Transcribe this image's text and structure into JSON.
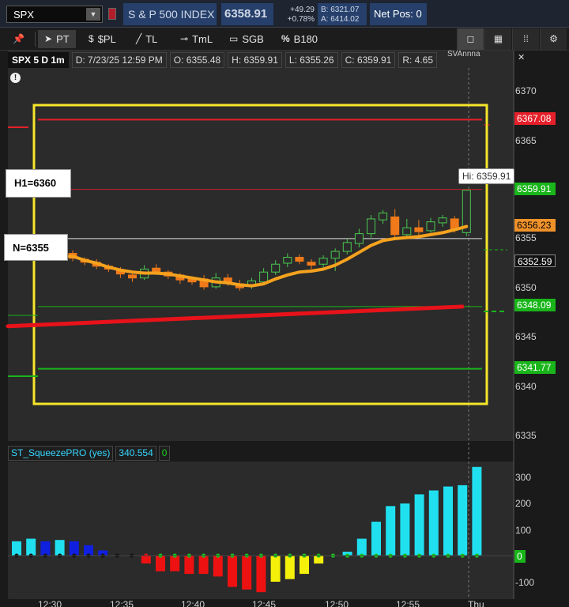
{
  "topbar": {
    "symbol": "SPX",
    "index_name": "S & P 500 INDEX",
    "last_price": "6358.91",
    "net_change": "+49.29",
    "pct_change": "+0.78%",
    "bid": "B: 6321.07",
    "ask": "A: 6414.02",
    "net_pos": "Net Pos: 0"
  },
  "toolbar": {
    "tools": [
      {
        "icon": "pin-icon",
        "label": ""
      },
      {
        "icon": "cursor-icon",
        "label": "PT"
      },
      {
        "icon": "dollar-icon",
        "label": "$PL"
      },
      {
        "icon": "trendline-icon",
        "label": "TL"
      },
      {
        "icon": "timeline-icon",
        "label": "TmL"
      },
      {
        "icon": "square-icon",
        "label": "SGB"
      },
      {
        "icon": "percent-icon",
        "label": "B180"
      }
    ],
    "right_buttons": [
      "single-window-icon",
      "grid-icon",
      "bars-icon",
      "gear-icon"
    ]
  },
  "chart_header": {
    "symbol": "SPX 5 D 1m",
    "date": "D: 7/23/25 12:59 PM",
    "open": "O: 6355.48",
    "high": "H: 6359.91",
    "low": "L: 6355.26",
    "close": "C: 6359.91",
    "range": "R: 4.65",
    "clipped_label": "SVAnnna"
  },
  "annotations": {
    "h1_label": "H1=6360",
    "n_label": "N=6355",
    "hi_tip": "Hi: 6359.91"
  },
  "price_axis": {
    "ticks": [
      "6370",
      "6365",
      "6360",
      "6355",
      "6350",
      "6345",
      "6340",
      "6335"
    ],
    "tags": [
      {
        "label": "6367.08",
        "bg": "#e5202a",
        "fg": "#ffffff"
      },
      {
        "label": "6359.91",
        "bg": "#19b51a",
        "fg": "#ffffff"
      },
      {
        "label": "6356.23",
        "bg": "#f0922a",
        "fg": "#000000"
      },
      {
        "label": "6352.59",
        "bg": "#111111",
        "fg": "#ffffff"
      },
      {
        "label": "6348.09",
        "bg": "#19b51a",
        "fg": "#ffffff"
      },
      {
        "label": "6341.77",
        "bg": "#19b51a",
        "fg": "#ffffff"
      }
    ]
  },
  "study": {
    "name": "ST_SqueezePRO (yes)",
    "value": "340.554",
    "signal": "0",
    "axis_ticks": [
      "300",
      "200",
      "100",
      "-100"
    ],
    "zero_tag": "0"
  },
  "time_axis": [
    "12:30",
    "12:35",
    "12:40",
    "12:45",
    "12:50",
    "12:55",
    "Thu"
  ],
  "chart_data": {
    "type": "candlestick",
    "y_range": [
      6333,
      6373
    ],
    "candles": [
      {
        "o": 6353.5,
        "c": 6353.0,
        "h": 6353.8,
        "l": 6352.7
      },
      {
        "o": 6352.9,
        "c": 6352.6,
        "h": 6353.1,
        "l": 6352.3
      },
      {
        "o": 6352.6,
        "c": 6352.2,
        "h": 6352.9,
        "l": 6351.9
      },
      {
        "o": 6352.2,
        "c": 6351.9,
        "h": 6352.4,
        "l": 6351.6
      },
      {
        "o": 6351.8,
        "c": 6351.4,
        "h": 6352.1,
        "l": 6351.0
      },
      {
        "o": 6351.3,
        "c": 6351.0,
        "h": 6351.6,
        "l": 6350.6
      },
      {
        "o": 6351.0,
        "c": 6351.9,
        "h": 6352.3,
        "l": 6350.8
      },
      {
        "o": 6352.0,
        "c": 6351.6,
        "h": 6352.4,
        "l": 6351.3
      },
      {
        "o": 6351.6,
        "c": 6351.2,
        "h": 6351.8,
        "l": 6350.9
      },
      {
        "o": 6351.3,
        "c": 6350.8,
        "h": 6351.5,
        "l": 6350.4
      },
      {
        "o": 6350.9,
        "c": 6350.6,
        "h": 6351.1,
        "l": 6350.3
      },
      {
        "o": 6350.9,
        "c": 6350.1,
        "h": 6351.3,
        "l": 6349.8
      },
      {
        "o": 6350.1,
        "c": 6351.0,
        "h": 6351.5,
        "l": 6349.9
      },
      {
        "o": 6351.0,
        "c": 6350.5,
        "h": 6351.4,
        "l": 6350.2
      },
      {
        "o": 6350.4,
        "c": 6350.0,
        "h": 6350.8,
        "l": 6349.7
      },
      {
        "o": 6350.2,
        "c": 6350.7,
        "h": 6351.0,
        "l": 6349.9
      },
      {
        "o": 6350.6,
        "c": 6351.6,
        "h": 6352.0,
        "l": 6350.4
      },
      {
        "o": 6351.6,
        "c": 6352.4,
        "h": 6352.8,
        "l": 6351.3
      },
      {
        "o": 6352.5,
        "c": 6353.1,
        "h": 6353.5,
        "l": 6352.1
      },
      {
        "o": 6353.1,
        "c": 6352.7,
        "h": 6353.4,
        "l": 6352.4
      },
      {
        "o": 6352.6,
        "c": 6352.3,
        "h": 6352.9,
        "l": 6351.9
      },
      {
        "o": 6352.4,
        "c": 6353.0,
        "h": 6353.3,
        "l": 6352.1
      },
      {
        "o": 6353.0,
        "c": 6353.7,
        "h": 6354.0,
        "l": 6351.7
      },
      {
        "o": 6353.7,
        "c": 6354.6,
        "h": 6355.0,
        "l": 6353.4
      },
      {
        "o": 6354.5,
        "c": 6355.5,
        "h": 6356.0,
        "l": 6354.1
      },
      {
        "o": 6355.5,
        "c": 6357.0,
        "h": 6357.4,
        "l": 6355.1
      },
      {
        "o": 6356.9,
        "c": 6357.6,
        "h": 6357.9,
        "l": 6356.5
      },
      {
        "o": 6357.2,
        "c": 6355.4,
        "h": 6358.0,
        "l": 6355.0
      },
      {
        "o": 6355.4,
        "c": 6356.1,
        "h": 6357.0,
        "l": 6355.0
      },
      {
        "o": 6356.1,
        "c": 6355.7,
        "h": 6356.9,
        "l": 6355.2
      },
      {
        "o": 6355.8,
        "c": 6356.7,
        "h": 6357.1,
        "l": 6355.6
      },
      {
        "o": 6356.6,
        "c": 6357.1,
        "h": 6357.4,
        "l": 6356.2
      },
      {
        "o": 6357.0,
        "c": 6355.9,
        "h": 6357.3,
        "l": 6355.6
      },
      {
        "o": 6355.6,
        "c": 6359.91,
        "h": 6359.91,
        "l": 6355.26
      }
    ],
    "orange_ma": [
      6353.2,
      6352.8,
      6352.5,
      6352.1,
      6351.8,
      6351.6,
      6351.5,
      6351.5,
      6351.4,
      6351.2,
      6351.0,
      6350.8,
      6350.6,
      6350.5,
      6350.3,
      6350.2,
      6350.4,
      6350.9,
      6351.3,
      6351.6,
      6351.7,
      6351.9,
      6352.3,
      6352.9,
      6353.6,
      6354.3,
      6354.8,
      6355.0,
      6355.1,
      6355.2,
      6355.4,
      6355.6,
      6355.9,
      6356.23
    ],
    "red_ma_start": 6346.1,
    "red_ma_end": 6348.09,
    "hlines": [
      {
        "name": "upper-red-line",
        "value": 6367.08,
        "color": "#e5202a"
      },
      {
        "name": "h1-line",
        "value": 6360.0,
        "color": "#c2202a"
      },
      {
        "name": "n-line",
        "value": 6355.0,
        "color": "#e0e0e0"
      },
      {
        "name": "mid-green-line",
        "value": 6348.09,
        "color": "#19b51a"
      },
      {
        "name": "lower-green-line",
        "value": 6341.77,
        "color": "#19b51a"
      }
    ],
    "squeeze": {
      "y_range": [
        -150,
        350
      ],
      "values": [
        55,
        65,
        55,
        60,
        55,
        40,
        20,
        0,
        0,
        -30,
        -60,
        -60,
        -70,
        -70,
        -80,
        -120,
        -130,
        -140,
        -100,
        -90,
        -70,
        -30,
        0,
        15,
        65,
        130,
        190,
        200,
        235,
        250,
        265,
        270,
        340
      ],
      "colors": [
        "#20e0f0",
        "#20e0f0",
        "#1020e0",
        "#20e0f0",
        "#1020e0",
        "#1020e0",
        "#1020e0",
        "#111111",
        "#111111",
        "#ee1111",
        "#ee1111",
        "#ee1111",
        "#ee1111",
        "#ee1111",
        "#ee1111",
        "#ee1111",
        "#ee1111",
        "#ee1111",
        "#f5f00a",
        "#f5f00a",
        "#f5f00a",
        "#f5f00a",
        "#f5f00a",
        "#20e0f0",
        "#20e0f0",
        "#20e0f0",
        "#20e0f0",
        "#20e0f0",
        "#20e0f0",
        "#20e0f0",
        "#20e0f0",
        "#20e0f0",
        "#20e0f0"
      ],
      "dot_colors": [
        "#111111",
        "#111111",
        "#111111",
        "#111111",
        "#111111",
        "#111111",
        "#111111",
        "#111111",
        "#111111",
        "#ee1111",
        "#19c51a",
        "#19c51a",
        "#19c51a",
        "#19c51a",
        "#19c51a",
        "#19c51a",
        "#19c51a",
        "#19c51a",
        "#19c51a",
        "#19c51a",
        "#19c51a",
        "#19c51a",
        "#19c51a",
        "#19c51a",
        "#19c51a",
        "#19c51a",
        "#19c51a",
        "#19c51a",
        "#19c51a",
        "#19c51a",
        "#19c51a",
        "#19c51a",
        "#19c51a"
      ]
    }
  }
}
